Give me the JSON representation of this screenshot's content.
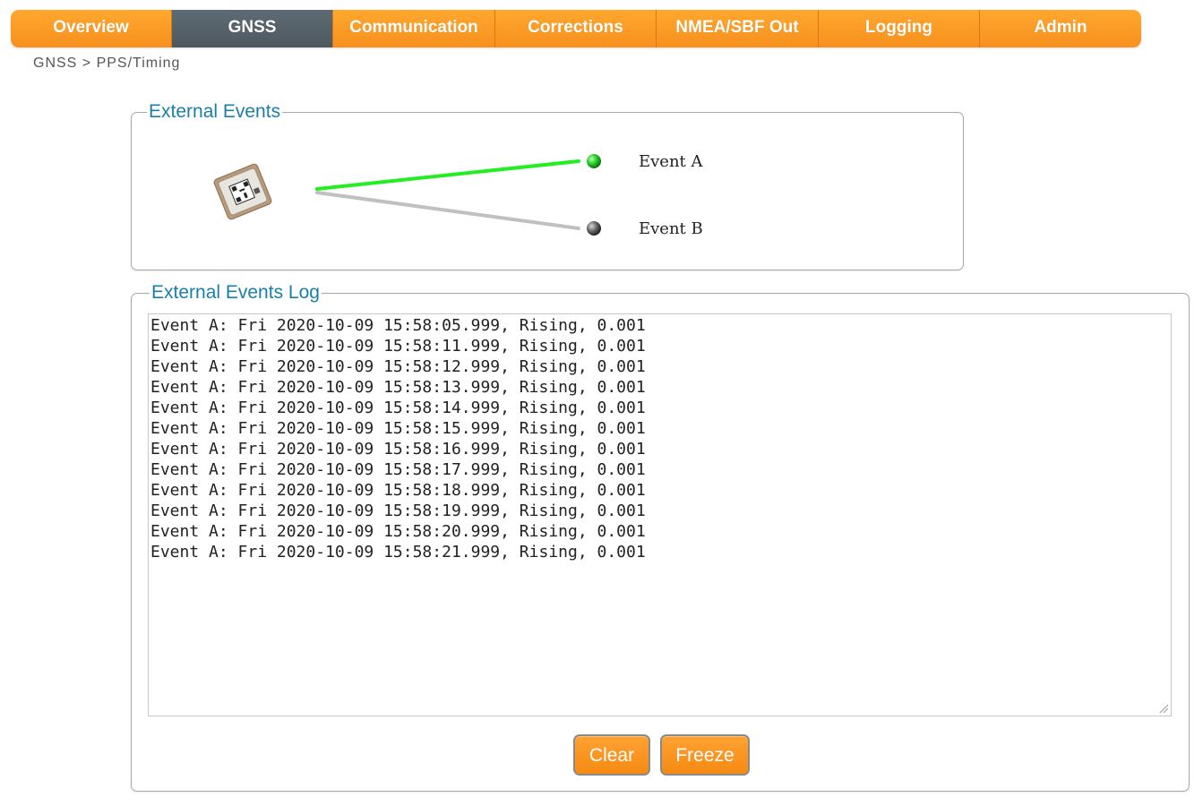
{
  "nav": {
    "items": [
      {
        "label": "Overview"
      },
      {
        "label": "GNSS"
      },
      {
        "label": "Communication"
      },
      {
        "label": "Corrections"
      },
      {
        "label": "NMEA/SBF Out"
      },
      {
        "label": "Logging"
      },
      {
        "label": "Admin"
      }
    ],
    "active": "GNSS"
  },
  "breadcrumb": "GNSS > PPS/Timing",
  "external_events": {
    "title": "External Events",
    "events": [
      {
        "label": "Event A",
        "status": "active",
        "color": "#22cc22"
      },
      {
        "label": "Event B",
        "status": "inactive",
        "color": "#555555"
      }
    ],
    "device_icon": "gnss-receiver-module-icon"
  },
  "log": {
    "title": "External Events Log",
    "lines": [
      "Event A: Fri 2020-10-09 15:58:05.999, Rising, 0.001",
      "Event A: Fri 2020-10-09 15:58:11.999, Rising, 0.001",
      "Event A: Fri 2020-10-09 15:58:12.999, Rising, 0.001",
      "Event A: Fri 2020-10-09 15:58:13.999, Rising, 0.001",
      "Event A: Fri 2020-10-09 15:58:14.999, Rising, 0.001",
      "Event A: Fri 2020-10-09 15:58:15.999, Rising, 0.001",
      "Event A: Fri 2020-10-09 15:58:16.999, Rising, 0.001",
      "Event A: Fri 2020-10-09 15:58:17.999, Rising, 0.001",
      "Event A: Fri 2020-10-09 15:58:18.999, Rising, 0.001",
      "Event A: Fri 2020-10-09 15:58:19.999, Rising, 0.001",
      "Event A: Fri 2020-10-09 15:58:20.999, Rising, 0.001",
      "Event A: Fri 2020-10-09 15:58:21.999, Rising, 0.001"
    ],
    "clear_label": "Clear",
    "freeze_label": "Freeze"
  },
  "colors": {
    "accent": "#f7931e",
    "nav_active": "#56626b",
    "legend_text": "#1a7fa8"
  }
}
